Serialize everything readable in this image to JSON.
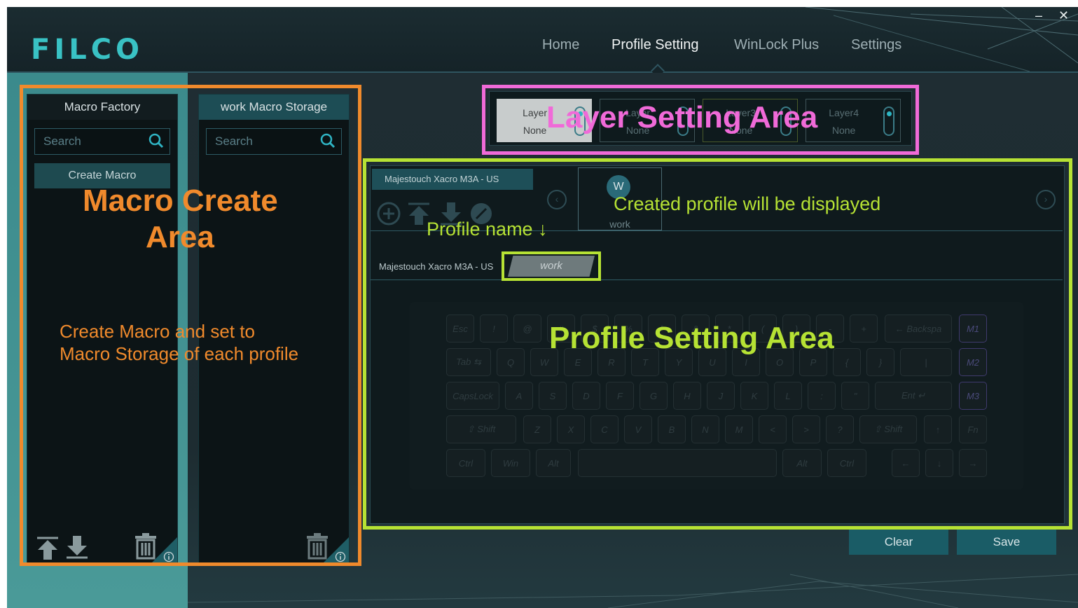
{
  "app": {
    "logo": "FILCO",
    "minimize": "–",
    "close": "✕"
  },
  "nav": {
    "items": [
      "Home",
      "Profile Setting",
      "WinLock Plus",
      "Settings"
    ],
    "active": "Profile Setting"
  },
  "macro_factory": {
    "title": "Macro Factory",
    "search_placeholder": "Search",
    "create_button": "Create Macro"
  },
  "macro_storage": {
    "title": "work Macro Storage",
    "search_placeholder": "Search"
  },
  "layers": [
    {
      "name": "Layer",
      "value": "None"
    },
    {
      "name": "Layer",
      "value": "None"
    },
    {
      "name": "Layer3",
      "value": "None"
    },
    {
      "name": "Layer4",
      "value": "None"
    }
  ],
  "profile": {
    "device": "Majestouch Xacro M3A - US",
    "avatar_letter": "W",
    "card_name": "work",
    "keyboard_device": "Majestouch Xacro M3A - US",
    "active_profile": "work"
  },
  "keyboard": {
    "row1": [
      "Esc",
      "!",
      "@",
      "#",
      "$",
      "%",
      "^",
      "&",
      "*",
      "(",
      ")",
      "-",
      "+",
      "← Backspa",
      "M1"
    ],
    "row2": [
      "Tab ⇆",
      "Q",
      "W",
      "E",
      "R",
      "T",
      "Y",
      "U",
      "I",
      "O",
      "P",
      "{",
      "}",
      "|",
      "M2"
    ],
    "row3": [
      "CapsLock",
      "A",
      "S",
      "D",
      "F",
      "G",
      "H",
      "J",
      "K",
      "L",
      ":",
      "\"",
      "Ent ↵",
      "M3"
    ],
    "row4": [
      "⇧ Shift",
      "Z",
      "X",
      "C",
      "V",
      "B",
      "N",
      "M",
      "<",
      ">",
      "?",
      "⇧ Shift",
      "↑",
      "Fn"
    ],
    "row5": [
      "Ctrl",
      "Win",
      "Alt",
      "",
      "Alt",
      "Ctrl",
      "←",
      "↓",
      "→"
    ]
  },
  "buttons": {
    "clear": "Clear",
    "save": "Save"
  },
  "annotations": {
    "macro_area_line1": "Macro Create",
    "macro_area_line2": "Area",
    "macro_desc_line1": "Create Macro and set to",
    "macro_desc_line2": "Macro Storage of each profile",
    "layer_area": "Layer Setting Area",
    "created_profile": "Created profile will be displayed",
    "profile_name": "Profile name ↓",
    "profile_area": "Profile Setting Area"
  },
  "colors": {
    "accent": "#39c2c4",
    "orange": "#f08a2c",
    "pink": "#f06ad8",
    "green": "#b6e234"
  }
}
